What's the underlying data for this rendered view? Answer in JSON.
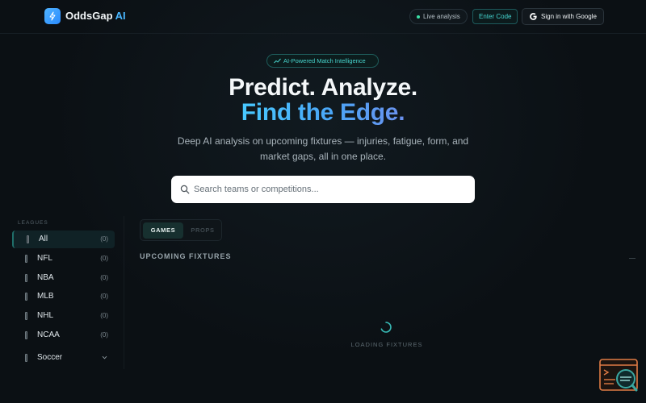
{
  "header": {
    "brand_name": "OddsGap",
    "brand_accent": "AI",
    "live_pill": "Live analysis",
    "enter_code": "Enter Code",
    "sign_in": "Sign in with Google"
  },
  "hero": {
    "badge": "AI-Powered Match Intelligence",
    "line1": "Predict. Analyze.",
    "line2": "Find the Edge.",
    "subtitle": "Deep AI analysis on upcoming fixtures — injuries, fatigue, form, and market gaps, all in one place."
  },
  "search": {
    "placeholder": "Search teams or competitions..."
  },
  "sidebar": {
    "heading": "LEAGUES",
    "items": [
      {
        "label": "All",
        "count": "(0)"
      },
      {
        "label": "NFL",
        "count": "(0)"
      },
      {
        "label": "NBA",
        "count": "(0)"
      },
      {
        "label": "MLB",
        "count": "(0)"
      },
      {
        "label": "NHL",
        "count": "(0)"
      },
      {
        "label": "NCAA",
        "count": "(0)"
      },
      {
        "label": "Soccer",
        "count": ""
      }
    ]
  },
  "tabs": {
    "games": "GAMES",
    "props": "PROPS"
  },
  "fixtures": {
    "title": "UPCOMING FIXTURES",
    "loading": "LOADING FIXTURES"
  },
  "colors": {
    "accent_teal": "#45d7d2",
    "accent_blue": "#4cb4f6",
    "live_green": "#3be0a6",
    "background": "#0b1014"
  },
  "icons": {
    "logo": "lightning-bolt-icon",
    "google": "google-g-icon",
    "badge": "trend-up-icon",
    "search": "search-icon",
    "spinner": "loading-spinner-icon",
    "widget": "terminal-search-icon"
  }
}
